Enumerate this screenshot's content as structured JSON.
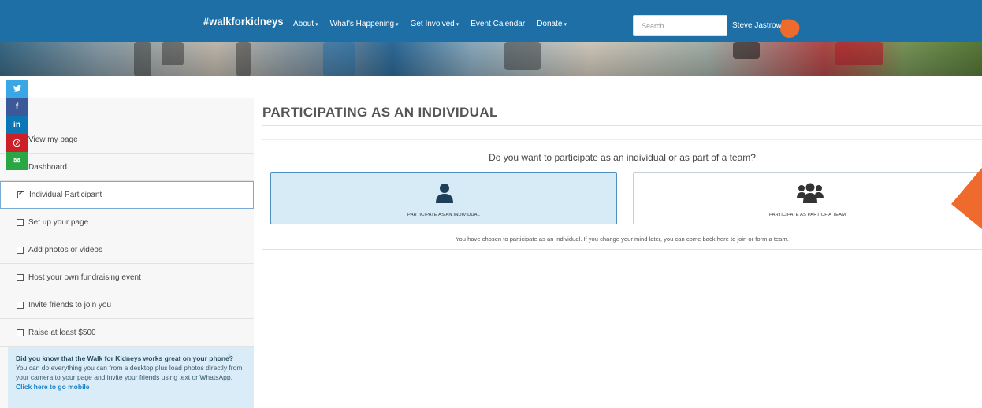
{
  "colors": {
    "nav_bg": "#1d6fa5",
    "accent_orange": "#ee6a2d",
    "selected_bg": "#d7ebf6",
    "sidebar_bg": "#f7f7f7"
  },
  "header": {
    "brand": "#walkforkidneys",
    "nav": [
      {
        "label": "About",
        "dropdown": true
      },
      {
        "label": "What's Happening",
        "dropdown": true
      },
      {
        "label": "Get Involved",
        "dropdown": true
      },
      {
        "label": "Event Calendar",
        "dropdown": false
      },
      {
        "label": "Donate",
        "dropdown": true
      }
    ],
    "search": {
      "placeholder": "Search...",
      "value": ""
    },
    "user": {
      "name": "Steve Jastrow",
      "avatar_icon": "user-avatar-icon"
    }
  },
  "social": [
    {
      "name": "twitter",
      "glyph": "🐦"
    },
    {
      "name": "facebook",
      "glyph": "f"
    },
    {
      "name": "linkedin",
      "glyph": "in"
    },
    {
      "name": "pinterest",
      "glyph": "℗"
    },
    {
      "name": "email",
      "glyph": "✉"
    }
  ],
  "sidebar": {
    "links": [
      {
        "label": "View my page"
      },
      {
        "label": "Dashboard"
      }
    ],
    "steps": [
      {
        "label": "Individual Participant",
        "checked": true,
        "active": true
      },
      {
        "label": "Set up your page",
        "checked": false
      },
      {
        "label": "Add photos or videos",
        "checked": false
      },
      {
        "label": "Host your own fundraising event",
        "checked": false
      },
      {
        "label": "Invite friends to join you",
        "checked": false
      },
      {
        "label": "Raise at least $500",
        "checked": false
      }
    ],
    "tip": {
      "title": "Did you know that the Walk for Kidneys works great on your phone?",
      "body": "You can do everything you can from a desktop plus load photos directly from your camera to your page and invite your friends using text or WhatsApp.",
      "link": "Click here to go mobile",
      "close": "×"
    }
  },
  "main": {
    "title": "PARTICIPATING AS AN INDIVIDUAL",
    "question": "Do you want to participate as an individual or as part of a team?",
    "options": {
      "individual": {
        "label": "PARTICIPATE AS AN INDIVIDUAL",
        "icon": "user-icon",
        "selected": true
      },
      "team": {
        "label": "PARTICIPATE AS PART OF A TEAM",
        "icon": "users-group-icon",
        "selected": false
      }
    },
    "chosen_note": "You have chosen to participate as an individual. If you change your mind later, you can come back here to join or form a team."
  }
}
